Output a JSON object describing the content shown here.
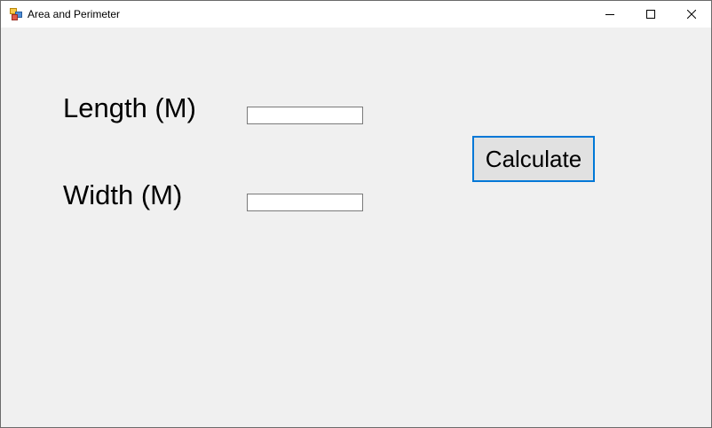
{
  "window": {
    "title": "Area and Perimeter",
    "icon": "winforms-app-icon",
    "controls": {
      "minimize": "minimize-icon",
      "maximize": "maximize-icon",
      "close": "close-icon"
    }
  },
  "form": {
    "length_label": "Length (M)",
    "width_label": "Width (M)",
    "length_value": "",
    "width_value": "",
    "calculate_label": "Calculate"
  },
  "colors": {
    "button_focus_border": "#0078d7",
    "client_background": "#f0f0f0"
  }
}
